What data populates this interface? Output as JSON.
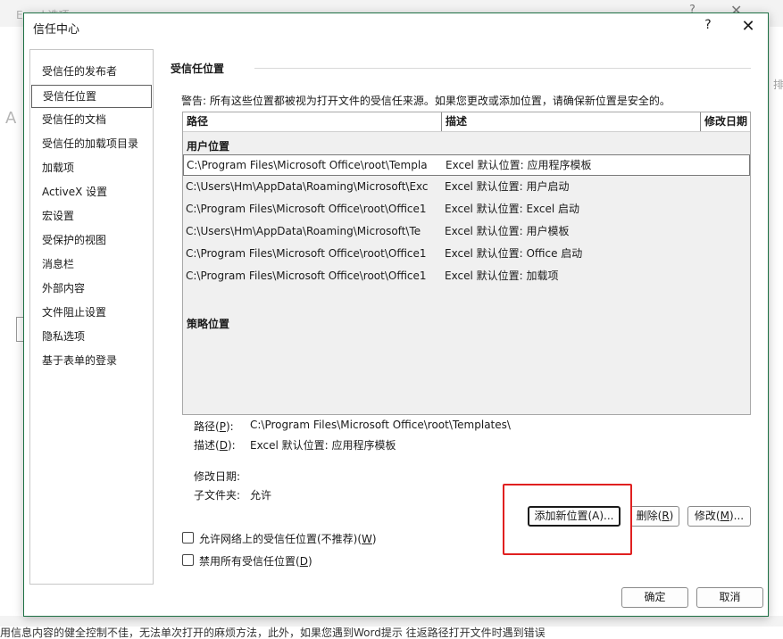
{
  "background": {
    "window_title": "Excel 选项",
    "help_glyph": "?",
    "close_glyph": "✕",
    "left_glyph": "A",
    "right_text": "排",
    "bottom_text": "用信息内容的健全控制不佳，无法单次打开的麻烦方法，此外，如果您遇到Word提示 往返路径打开文件时遇到错误"
  },
  "dialog": {
    "title": "信任中心",
    "help_glyph": "?",
    "close_glyph": "✕"
  },
  "nav": {
    "items": [
      {
        "label": "受信任的发布者",
        "selected": false
      },
      {
        "label": "受信任位置",
        "selected": true
      },
      {
        "label": "受信任的文档",
        "selected": false
      },
      {
        "label": "受信任的加载项目录",
        "selected": false
      },
      {
        "label": "加载项",
        "selected": false
      },
      {
        "label": "ActiveX 设置",
        "selected": false
      },
      {
        "label": "宏设置",
        "selected": false
      },
      {
        "label": "受保护的视图",
        "selected": false
      },
      {
        "label": "消息栏",
        "selected": false
      },
      {
        "label": "外部内容",
        "selected": false
      },
      {
        "label": "文件阻止设置",
        "selected": false
      },
      {
        "label": "隐私选项",
        "selected": false
      },
      {
        "label": "基于表单的登录",
        "selected": false
      }
    ]
  },
  "main": {
    "section_title": "受信任位置",
    "warning": "警告: 所有这些位置都被视为打开文件的受信任来源。如果您更改或添加位置，请确保新位置是安全的。",
    "columns": {
      "path": "路径",
      "description": "描述",
      "modified": "修改日期"
    },
    "user_group_label": "用户位置",
    "policy_group_label": "策略位置",
    "rows": [
      {
        "path": "C:\\Program Files\\Microsoft Office\\root\\Templa",
        "description": "Excel 默认位置: 应用程序模板",
        "selected": true
      },
      {
        "path": "C:\\Users\\Hm\\AppData\\Roaming\\Microsoft\\Exc",
        "description": "Excel 默认位置: 用户启动",
        "selected": false
      },
      {
        "path": "C:\\Program Files\\Microsoft Office\\root\\Office1",
        "description": "Excel 默认位置: Excel 启动",
        "selected": false
      },
      {
        "path": "C:\\Users\\Hm\\AppData\\Roaming\\Microsoft\\Te",
        "description": "Excel 默认位置: 用户模板",
        "selected": false
      },
      {
        "path": "C:\\Program Files\\Microsoft Office\\root\\Office1",
        "description": "Excel 默认位置: Office 启动",
        "selected": false
      },
      {
        "path": "C:\\Program Files\\Microsoft Office\\root\\Office1",
        "description": "Excel 默认位置: 加载项",
        "selected": false
      }
    ],
    "details": {
      "path_label": "路径(",
      "path_key": "P",
      "path_label_end": "):",
      "path_value": "C:\\Program Files\\Microsoft Office\\root\\Templates\\",
      "desc_label": "描述(",
      "desc_key": "D",
      "desc_label_end": "):",
      "desc_value": "Excel 默认位置: 应用程序模板",
      "modified_label": "修改日期:",
      "subfolders_label": "子文件夹:",
      "subfolders_value": "允许"
    },
    "buttons": {
      "add_new": "添加新位置(A)...",
      "remove_text": "删除(",
      "remove_key": "R",
      "remove_end": ")",
      "modify_text": "修改(",
      "modify_key": "M",
      "modify_end": ")..."
    },
    "checkboxes": {
      "allow_network_text": "允许网络上的受信任位置(不推荐)(",
      "allow_network_key": "W",
      "allow_network_end": ")",
      "allow_network_checked": false,
      "disable_all_text": "禁用所有受信任位置(",
      "disable_all_key": "D",
      "disable_all_end": ")",
      "disable_all_checked": false
    }
  },
  "footer": {
    "ok": "确定",
    "cancel": "取消"
  },
  "colors": {
    "dialog_border": "#1e7145",
    "highlight": "#e02020"
  }
}
